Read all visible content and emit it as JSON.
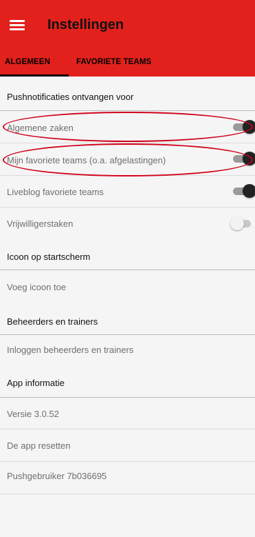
{
  "app": {
    "title": "Instellingen",
    "accent_color": "#e2211c",
    "menu_icon": "hamburger-menu-icon"
  },
  "tabs": [
    {
      "label": "ALGEMEEN",
      "selected": true
    },
    {
      "label": "FAVORIETE TEAMS",
      "selected": false
    }
  ],
  "sections": {
    "push": "Pushnotificaties ontvangen voor",
    "icon": "Icoon op startscherm",
    "admins": "Beheerders en trainers",
    "appinfo": "App informatie"
  },
  "push_items": [
    {
      "label": "Algemene zaken",
      "enabled": true
    },
    {
      "label": "Mijn favoriete teams (o.a. afgelastingen)",
      "enabled": true
    },
    {
      "label": "Liveblog favoriete teams",
      "enabled": true
    },
    {
      "label": "Vrijwilligerstaken",
      "enabled": false
    }
  ],
  "items": {
    "add_icon": "Voeg icoon toe",
    "login": "Inloggen beheerders en trainers",
    "version": "Versie 3.0.52",
    "reset": "De app resetten",
    "push_user": "Pushgebruiker 7b036695"
  },
  "annotation_color": "#d0021b"
}
